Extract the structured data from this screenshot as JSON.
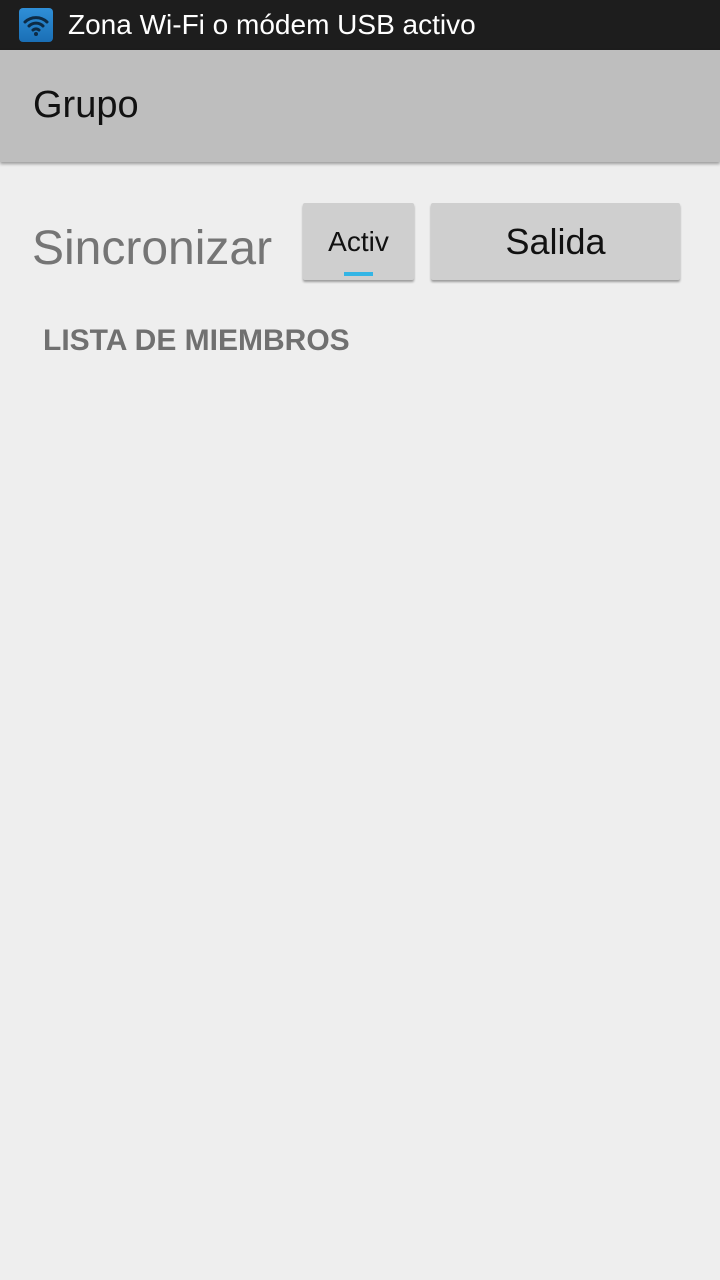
{
  "status_bar": {
    "icon": "wifi-hotspot-icon",
    "notification_text": "Zona Wi-Fi o módem USB activo",
    "icon_color": "#2f8fd8"
  },
  "action_bar": {
    "title": "Grupo"
  },
  "sync": {
    "label": "Sincronizar",
    "toggle_label": "Activ",
    "toggle_state": "on",
    "indicator_color": "#33b5e5"
  },
  "exit_button": {
    "label": "Salida"
  },
  "members": {
    "header": "LISTA DE MIEMBROS",
    "items": []
  }
}
